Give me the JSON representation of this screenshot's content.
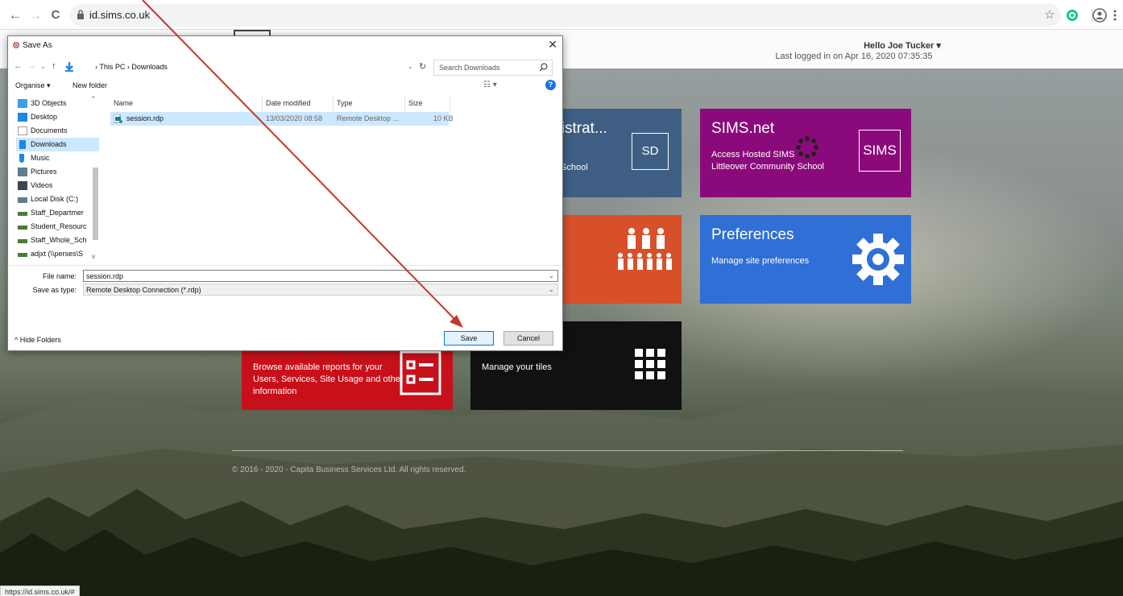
{
  "browser": {
    "url": "id.sims.co.uk",
    "back_icon": "←",
    "forward_icon": "→",
    "reload_icon": "C",
    "star_icon": "☆"
  },
  "header": {
    "greeting": "Hello Joe Tucker",
    "greeting_caret": "▾",
    "last_login": "Last logged in on Apr 16, 2020 07:35:35"
  },
  "tiles": {
    "admin": {
      "title_fragment": "inistrat...",
      "desc_fragment": "School",
      "badge": "SD",
      "color": "#3e5f83"
    },
    "simsnet": {
      "title": "SIMS.net",
      "desc_line1": "Access Hosted SIMS",
      "desc_line2": "Littleover Community School",
      "badge": "SIMS",
      "color": "#8b0a7b"
    },
    "users": {
      "color": "#d7502a"
    },
    "preferences": {
      "title": "Preferences",
      "desc": "Manage site preferences",
      "color": "#2f6fd6"
    },
    "reports": {
      "desc_line1": "Browse available reports for your",
      "desc_line2": "Users, Services, Site Usage and other",
      "desc_line3": "information",
      "color": "#c8101a"
    },
    "tiles": {
      "desc": "Manage your tiles",
      "color": "#111111"
    }
  },
  "footer": {
    "copyright": "© 2016 - 2020 - Capita Business Services Ltd. All rights reserved."
  },
  "status_bar": {
    "url": "https://id.sims.co.uk/#"
  },
  "dialog": {
    "title": "Save As",
    "close": "✕",
    "path_prefix": "This PC",
    "path_sep": "›",
    "path_folder": "Downloads",
    "search_placeholder": "Search Downloads",
    "organise": "Organise ▾",
    "new_folder": "New folder",
    "help": "?",
    "nav_items": [
      {
        "label": "3D Objects",
        "icon": "cube-icon",
        "color": "#3aa0e8"
      },
      {
        "label": "Desktop",
        "icon": "desktop-icon",
        "color": "#1e88e5"
      },
      {
        "label": "Documents",
        "icon": "document-icon",
        "color": "#9e9e9e"
      },
      {
        "label": "Downloads",
        "icon": "download-icon",
        "color": "#1e88e5"
      },
      {
        "label": "Music",
        "icon": "music-icon",
        "color": "#1e88e5"
      },
      {
        "label": "Pictures",
        "icon": "pictures-icon",
        "color": "#607d8b"
      },
      {
        "label": "Videos",
        "icon": "videos-icon",
        "color": "#37474f"
      },
      {
        "label": "Local Disk (C:)",
        "icon": "disk-icon",
        "color": "#607d8b"
      },
      {
        "label": "Staff_Departmer",
        "icon": "network-drive-icon",
        "color": "#4a7c3a"
      },
      {
        "label": "Student_Resourc",
        "icon": "network-drive-icon",
        "color": "#4a7c3a"
      },
      {
        "label": "Staff_Whole_Sch",
        "icon": "network-drive-icon",
        "color": "#4a7c3a"
      },
      {
        "label": "adjxt (\\\\perses\\S",
        "icon": "network-drive-icon",
        "color": "#4a7c3a"
      }
    ],
    "columns": [
      "Name",
      "Date modified",
      "Type",
      "Size"
    ],
    "files": [
      {
        "name": "session.rdp",
        "modified": "13/03/2020 08:58",
        "type": "Remote Desktop ...",
        "size": "10 KB"
      }
    ],
    "file_name_label": "File name:",
    "file_name_value": "session.rdp",
    "save_type_label": "Save as type:",
    "save_type_value": "Remote Desktop Connection (*.rdp)",
    "hide_folders": "Hide Folders",
    "save": "Save",
    "cancel": "Cancel"
  }
}
